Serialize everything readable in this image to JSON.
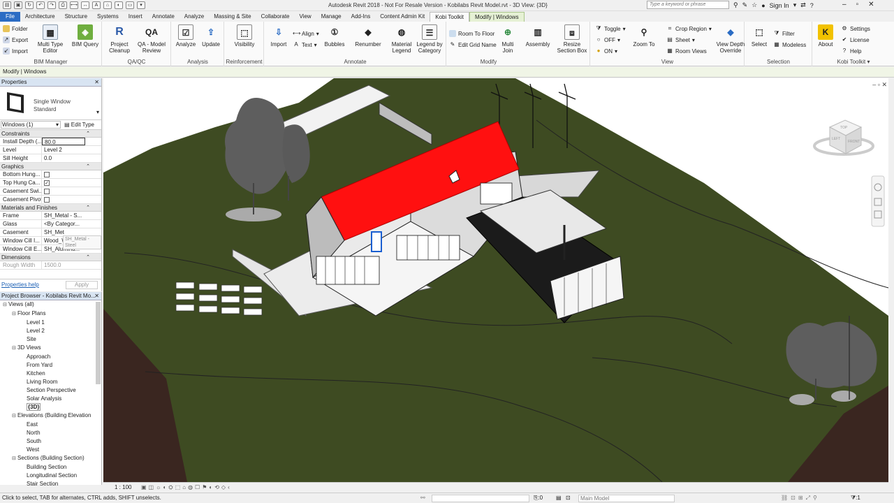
{
  "window": {
    "title": "Autodesk Revit 2018 - Not For Resale Version -    Kobilabs Revit Model.rvt - 3D View: {3D}",
    "search_placeholder": "Type a keyword or phrase",
    "sign_in": "Sign In"
  },
  "tabs": [
    "File",
    "Architecture",
    "Structure",
    "Systems",
    "Insert",
    "Annotate",
    "Analyze",
    "Massing & Site",
    "Collaborate",
    "View",
    "Manage",
    "Add-Ins",
    "Content Admin Kit",
    "Kobi Toolkit",
    "Modify | Windows"
  ],
  "ribbon": {
    "bim_manager": {
      "title": "BIM Manager",
      "folder": "Folder",
      "export": "Export",
      "import": "Import",
      "multi_type_editor": "Multi Type\nEditor",
      "bim_query": "BIM Query"
    },
    "qa_qc": {
      "title": "QA/QC",
      "project_cleanup": "Project\nCleanup",
      "qa_model_review": "QA - Model\nReview",
      "qa_icon": "QA"
    },
    "analysis": {
      "title": "Analysis",
      "analyze": "Analyze",
      "update": "Update"
    },
    "reinforcement": {
      "title": "Reinforcement",
      "visibility": "Visibility"
    },
    "annotate": {
      "title": "Annotate",
      "import": "Import",
      "align": "Align",
      "text": "Text",
      "bubbles": "Bubbles",
      "renumber": "Renumber"
    },
    "modify": {
      "title": "Modify",
      "material_legend": "Material\nLegend",
      "legend_by_category": "Legend by\nCategory",
      "room_to_floor": "Room To Floor",
      "edit_grid_name": "Edit Grid Name",
      "multi_join": "Multi\nJoin",
      "assembly": "Assembly",
      "resize_section_box": "Resize\nSection Box"
    },
    "view": {
      "title": "View",
      "toggle": "Toggle",
      "off": "OFF",
      "on": "ON",
      "zoom_to": "Zoom To",
      "crop_region": "Crop Region",
      "sheet": "Sheet",
      "room_views": "Room Views",
      "view_depth_override": "View Depth\nOverride"
    },
    "selection": {
      "title": "Selection",
      "select": "Select",
      "filter": "Filter",
      "modeless": "Modeless"
    },
    "kobi_toolkit": {
      "title": "Kobi Toolkit",
      "about": "About",
      "settings": "Settings",
      "license": "License",
      "help": "Help"
    }
  },
  "context_bar": "Modify | Windows",
  "properties": {
    "title": "Properties",
    "type_name": "Single Window\nStandard",
    "instance_selector": "Windows (1)",
    "edit_type": "Edit Type",
    "groups": [
      {
        "name": "Constraints",
        "rows": [
          {
            "k": "Install Depth (...",
            "v": "80.0"
          },
          {
            "k": "Level",
            "v": "Level 2"
          },
          {
            "k": "Sill Height",
            "v": "0.0"
          }
        ]
      },
      {
        "name": "Graphics",
        "rows": [
          {
            "k": "Bottom Hung...",
            "v": "",
            "chk": false
          },
          {
            "k": "Top Hung Ca...",
            "v": "",
            "chk": true
          },
          {
            "k": "Casement Swi...",
            "v": "",
            "chk": false
          },
          {
            "k": "Casement Pivot",
            "v": "",
            "chk": false
          }
        ]
      },
      {
        "name": "Materials and Finishes",
        "rows": [
          {
            "k": "Frame",
            "v": "SH_Metal - S..."
          },
          {
            "k": "Glass",
            "v": "<By Categor..."
          },
          {
            "k": "Casement",
            "v": "SH_Met"
          },
          {
            "k": "Window Cill I...",
            "v": "Wood_Wain..."
          },
          {
            "k": "Window Cill E...",
            "v": "SH_Aluminu..."
          }
        ]
      },
      {
        "name": "Dimensions",
        "rows": [
          {
            "k": "Rough Width",
            "v": "1500.0"
          }
        ]
      }
    ],
    "tooltip": "SH_Metal - Steel",
    "help": "Properties help",
    "apply": "Apply"
  },
  "project_browser": {
    "title": "Project Browser - Kobilabs Revit Mo...",
    "items": [
      {
        "label": "Views (all)",
        "lvl": 0,
        "tog": "⊟"
      },
      {
        "label": "Floor Plans",
        "lvl": 1,
        "tog": "⊟"
      },
      {
        "label": "Level 1",
        "lvl": 2
      },
      {
        "label": "Level 2",
        "lvl": 2
      },
      {
        "label": "Site",
        "lvl": 2
      },
      {
        "label": "3D Views",
        "lvl": 1,
        "tog": "⊟"
      },
      {
        "label": "Approach",
        "lvl": 2
      },
      {
        "label": "From Yard",
        "lvl": 2
      },
      {
        "label": "Kitchen",
        "lvl": 2
      },
      {
        "label": "Living Room",
        "lvl": 2
      },
      {
        "label": "Section Perspective",
        "lvl": 2
      },
      {
        "label": "Solar Analysis",
        "lvl": 2
      },
      {
        "label": "{3D}",
        "lvl": 2,
        "bold": true
      },
      {
        "label": "Elevations (Building Elevation",
        "lvl": 1,
        "tog": "⊟"
      },
      {
        "label": "East",
        "lvl": 2
      },
      {
        "label": "North",
        "lvl": 2
      },
      {
        "label": "South",
        "lvl": 2
      },
      {
        "label": "West",
        "lvl": 2
      },
      {
        "label": "Sections (Building Section)",
        "lvl": 1,
        "tog": "⊟"
      },
      {
        "label": "Building Section",
        "lvl": 2
      },
      {
        "label": "Longitudinal Section",
        "lvl": 2
      },
      {
        "label": "Stair Section",
        "lvl": 2
      }
    ]
  },
  "view_control": {
    "scale": "1 : 100"
  },
  "status": {
    "hint": "Click to select, TAB for alternates, CTRL adds, SHIFT unselects.",
    "zero": ":0",
    "model": "Main Model",
    "filter_count": ":1"
  },
  "viewcube": {
    "top": "TOP",
    "front": "FRONT",
    "left": "LEFT"
  },
  "colors": {
    "roof": "#ff1010",
    "terrain": "#3d4a22",
    "file_tab": "#2b6cc4",
    "context_tab": "#e6f1d5"
  }
}
